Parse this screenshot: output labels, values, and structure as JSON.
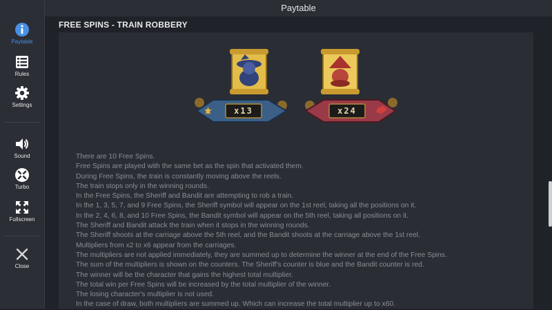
{
  "header": {
    "title": "Paytable"
  },
  "sidebar": {
    "items": [
      {
        "label": "Paytable",
        "icon": "info-icon"
      },
      {
        "label": "Rules",
        "icon": "list-icon"
      },
      {
        "label": "Settings",
        "icon": "gear-icon"
      },
      {
        "label": "Sound",
        "icon": "speaker-icon"
      },
      {
        "label": "Turbo",
        "icon": "turbo-icon"
      },
      {
        "label": "Fullscreen",
        "icon": "fullscreen-icon"
      },
      {
        "label": "Close",
        "icon": "close-icon"
      }
    ]
  },
  "section": {
    "title": "FREE SPINS - TRAIN ROBBERY",
    "sheriff_counter": "x13",
    "bandit_counter": "x24",
    "lines": [
      "There are 10 Free Spins.",
      "Free Spins are played with the same bet as the spin that activated them.",
      "During Free Spins, the train is constantly moving above the reels.",
      "The train stops only in the winning rounds.",
      "In the Free Spins, the Sheriff and Bandit are attempting to rob a train.",
      "In the 1, 3, 5, 7, and 9 Free Spins, the Sheriff symbol will appear on the 1st reel, taking all the positions on it.",
      "In the 2, 4, 6, 8, and 10 Free Spins, the Bandit symbol will appear on the 5th reel, taking all positions on it.",
      "The Sheriff and Bandit attack the train when it stops in the winning rounds.",
      "The Sheriff shoots at the carriage above the 5th reel, and the Bandit shoots at the carriage above the 1st reel.",
      "Multipliers from x2 to x6 appear from the carriages.",
      "The multipliers are not applied immediately, they are summed up to determine the winner at the end of the Free Spins.",
      "The sum of the multipliers is shown on the counters. The Sheriff's counter is blue and the Bandit counter is red.",
      "The winner will be the character that gains the highest total multiplier.",
      "The total win per Free Spins will be increased by the total multiplier of the winner.",
      "The losing character's multiplier is not used.",
      "In the case of draw, both multipliers are summed up. Which can increase the total multiplier up to x60."
    ]
  },
  "colors": {
    "accent": "#4a90e2",
    "sheriff": "#3b5f86",
    "bandit": "#9a3a48",
    "parchment": "#e5c14a"
  }
}
